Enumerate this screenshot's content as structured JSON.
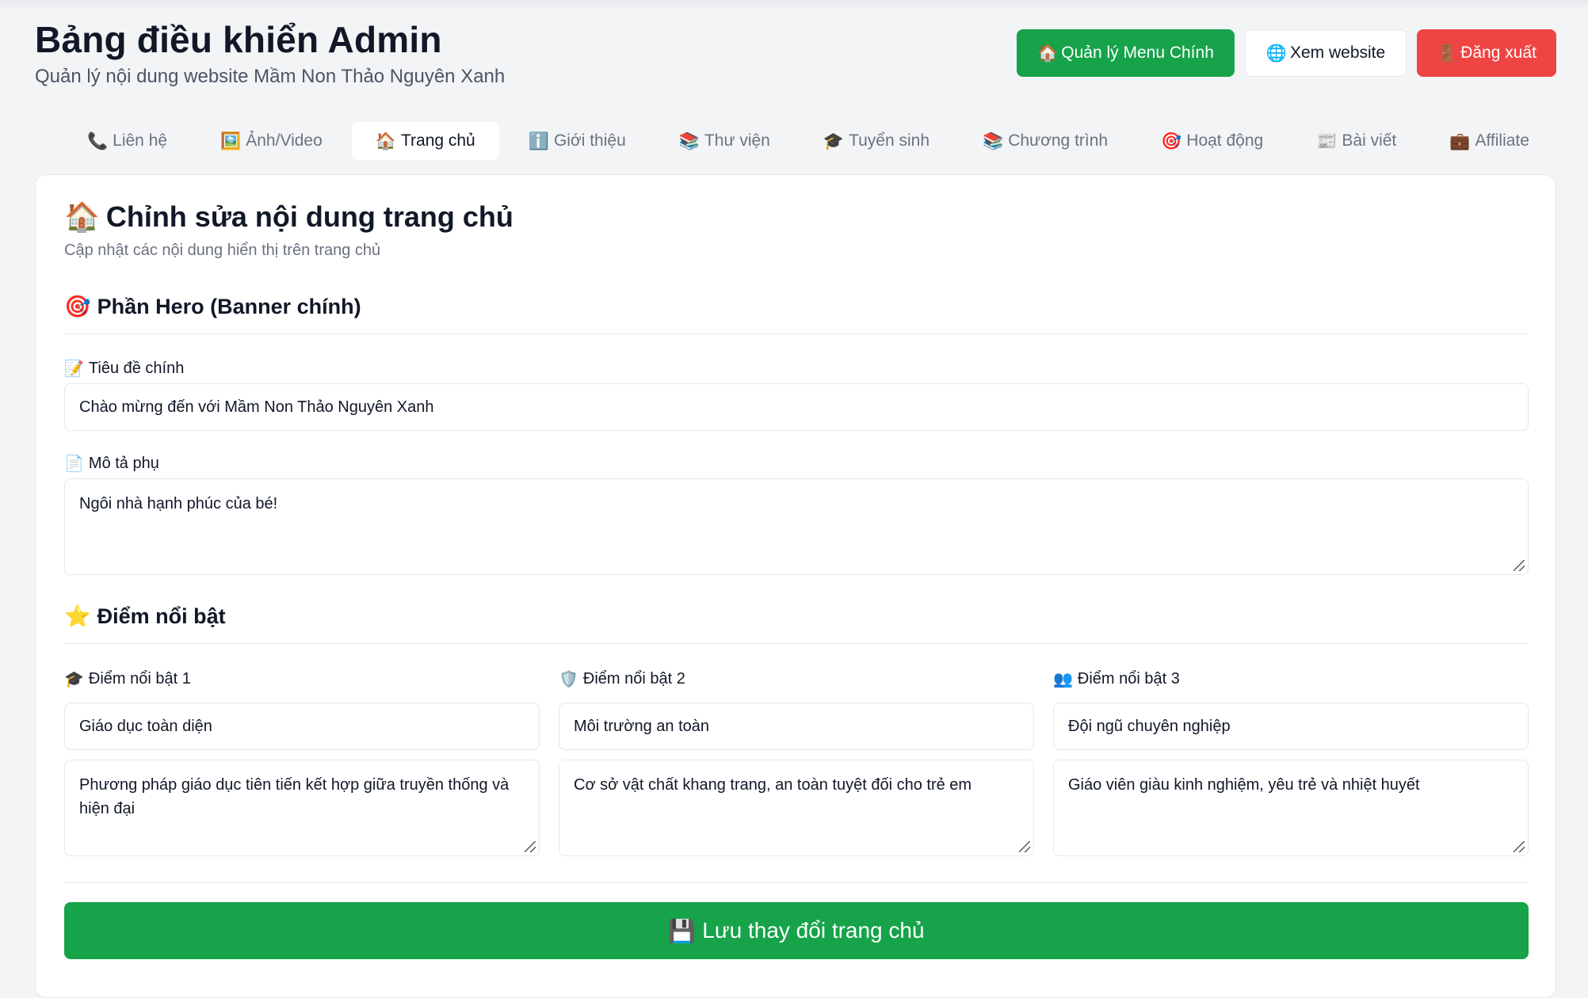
{
  "header": {
    "title": "Bảng điều khiển Admin",
    "subtitle": "Quản lý nội dung website Mầm Non Thảo Nguyên Xanh",
    "actions": [
      {
        "icon": "🏠",
        "icon_name": "house-icon",
        "label": "Quản lý Menu Chính",
        "color": "#16a34a"
      },
      {
        "icon": "🌐",
        "icon_name": "globe-icon",
        "label": "Xem website",
        "color": "#ffffff"
      },
      {
        "icon": "🚪",
        "icon_name": "door-icon",
        "label": "Đăng xuất",
        "color": "#ef4444"
      }
    ]
  },
  "tabs": [
    {
      "icon": "📞",
      "icon_name": "phone-icon",
      "label": "Liên hệ",
      "active": false
    },
    {
      "icon": "🖼️",
      "icon_name": "picture-icon",
      "label": "Ảnh/Video",
      "active": false
    },
    {
      "icon": "🏠",
      "icon_name": "house-icon",
      "label": "Trang chủ",
      "active": true
    },
    {
      "icon": "ℹ️",
      "icon_name": "info-icon",
      "label": "Giới thiệu",
      "active": false
    },
    {
      "icon": "📚",
      "icon_name": "books-icon",
      "label": "Thư viện",
      "active": false
    },
    {
      "icon": "🎓",
      "icon_name": "graduation-cap-icon",
      "label": "Tuyển sinh",
      "active": false
    },
    {
      "icon": "📚",
      "icon_name": "books-icon",
      "label": "Chương trình",
      "active": false
    },
    {
      "icon": "🎯",
      "icon_name": "target-icon",
      "label": "Hoạt động",
      "active": false
    },
    {
      "icon": "📰",
      "icon_name": "newspaper-icon",
      "label": "Bài viết",
      "active": false
    },
    {
      "icon": "💼",
      "icon_name": "briefcase-icon",
      "label": "Affiliate",
      "active": false
    }
  ],
  "editor": {
    "icon": "🏠",
    "title": "Chỉnh sửa nội dung trang chủ",
    "description": "Cập nhật các nội dung hiển thị trên trang chủ",
    "hero": {
      "icon": "🎯",
      "section_title": "Phần Hero (Banner chính)",
      "title_label_icon": "📝",
      "title_label": "Tiêu đề chính",
      "title_value": "Chào mừng đến với Mầm Non Thảo Nguyên Xanh",
      "subtitle_label_icon": "📄",
      "subtitle_label": "Mô tả phụ",
      "subtitle_value": "Ngôi nhà hạnh phúc của bé!"
    },
    "highlights": {
      "icon": "⭐",
      "section_title": "Điểm nổi bật",
      "items": [
        {
          "icon": "🎓",
          "icon_name": "graduation-cap-icon",
          "label": "Điểm nổi bật 1",
          "title": "Giáo dục toàn diện",
          "description": "Phương pháp giáo dục tiên tiến kết hợp giữa truyền thống và hiện đại"
        },
        {
          "icon": "🛡️",
          "icon_name": "shield-icon",
          "label": "Điểm nổi bật 2",
          "title": "Môi trường an toàn",
          "description": "Cơ sở vật chất khang trang, an toàn tuyệt đối cho trẻ em"
        },
        {
          "icon": "👥",
          "icon_name": "people-icon",
          "label": "Điểm nổi bật 3",
          "title": "Đội ngũ chuyên nghiệp",
          "description": "Giáo viên giàu kinh nghiệm, yêu trẻ và nhiệt huyết"
        }
      ]
    },
    "save_icon": "💾",
    "save_label": "Lưu thay đổi trang chủ"
  }
}
